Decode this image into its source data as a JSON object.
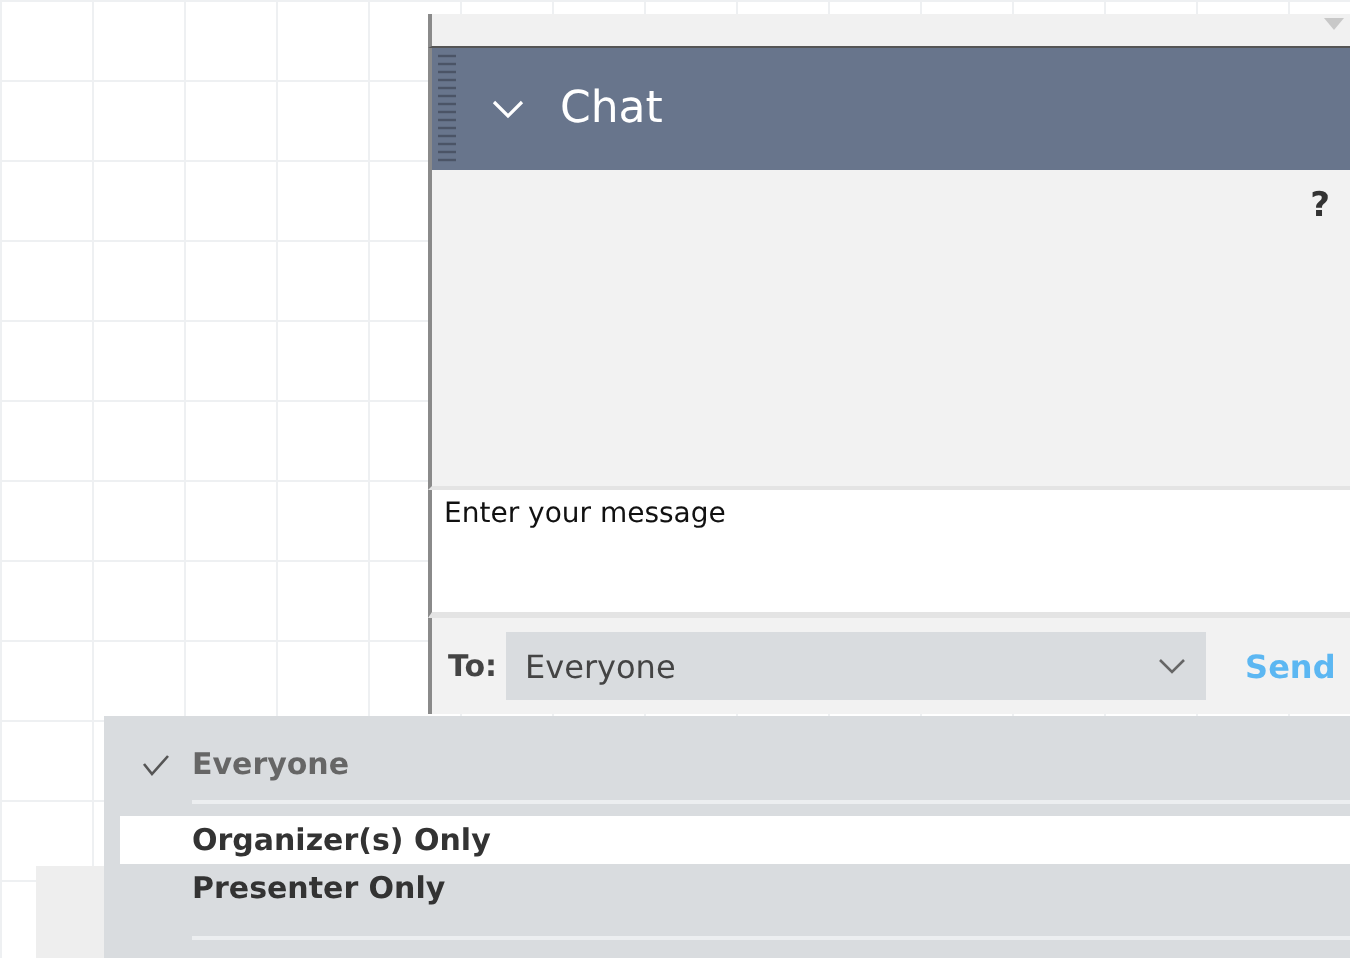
{
  "chat_panel": {
    "title": "Chat",
    "expanded": true,
    "help": "?",
    "message": {
      "placeholder": "Enter your message"
    },
    "to_label": "To:",
    "recipient": "Everyone",
    "send": "Send"
  },
  "recipient_menu": [
    {
      "label": "Everyone",
      "checked": true,
      "highlighted": false
    },
    {
      "label": "Organizer(s) Only",
      "checked": false,
      "highlighted": true
    },
    {
      "label": "Presenter Only",
      "checked": false,
      "highlighted": false
    }
  ]
}
